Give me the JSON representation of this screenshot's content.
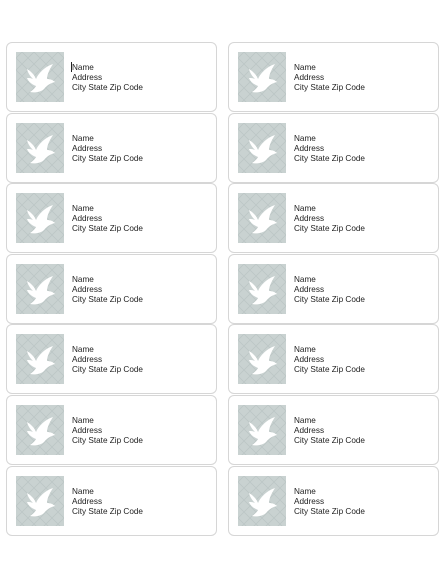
{
  "document": {
    "labels": [
      {
        "name": "Name",
        "address": "Address",
        "city_line": "City State Zip Code"
      },
      {
        "name": "Name",
        "address": "Address",
        "city_line": "City State Zip Code"
      },
      {
        "name": "Name",
        "address": "Address",
        "city_line": "City State Zip Code"
      },
      {
        "name": "Name",
        "address": "Address",
        "city_line": "City State Zip Code"
      },
      {
        "name": "Name",
        "address": "Address",
        "city_line": "City State Zip Code"
      },
      {
        "name": "Name",
        "address": "Address",
        "city_line": "City State Zip Code"
      },
      {
        "name": "Name",
        "address": "Address",
        "city_line": "City State Zip Code"
      },
      {
        "name": "Name",
        "address": "Address",
        "city_line": "City State Zip Code"
      },
      {
        "name": "Name",
        "address": "Address",
        "city_line": "City State Zip Code"
      },
      {
        "name": "Name",
        "address": "Address",
        "city_line": "City State Zip Code"
      },
      {
        "name": "Name",
        "address": "Address",
        "city_line": "City State Zip Code"
      },
      {
        "name": "Name",
        "address": "Address",
        "city_line": "City State Zip Code"
      },
      {
        "name": "Name",
        "address": "Address",
        "city_line": "City State Zip Code"
      },
      {
        "name": "Name",
        "address": "Address",
        "city_line": "City State Zip Code"
      }
    ],
    "image_icon": "dove-icon",
    "colors": {
      "thumb_bg": "#c9d2d1",
      "dove": "#ffffff",
      "border": "#d6d6d6",
      "text": "#222222"
    }
  }
}
